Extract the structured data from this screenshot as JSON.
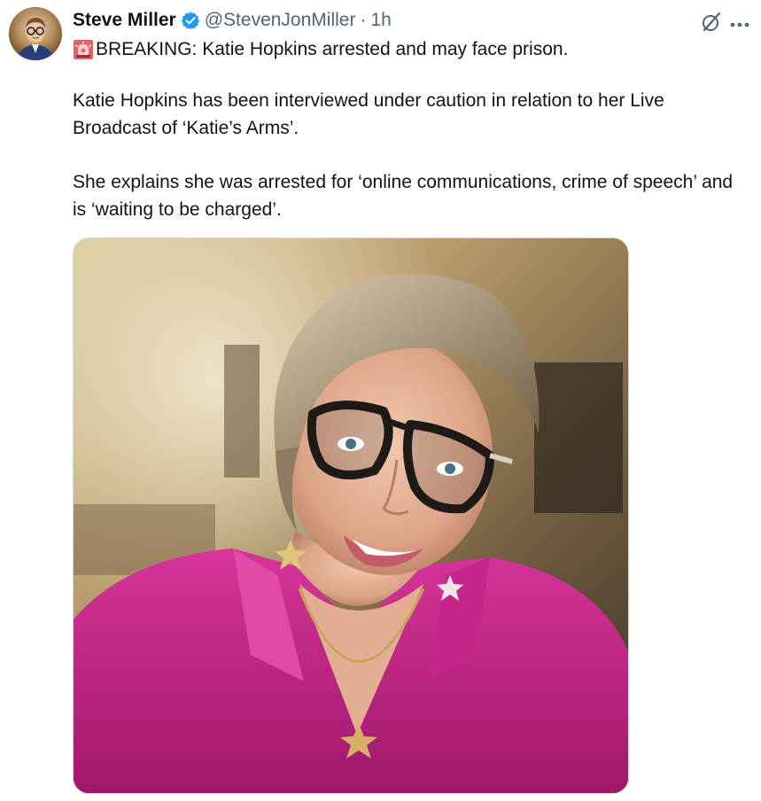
{
  "tweet": {
    "author": {
      "display_name": "Steve Miller",
      "handle": "@StevenJonMiller",
      "separator": "·",
      "time": "1h",
      "verified": true
    },
    "line1_icon": "police-car-light-icon",
    "line1_text": "BREAKING: Katie Hopkins arrested and may face prison.",
    "paragraph2": "Katie Hopkins has been interviewed under caution in relation to her Live Broadcast of ‘Katie’s Arms’.",
    "paragraph3": "She explains she was arrested for ‘online communications, crime of speech’ and is ‘waiting to be charged’.",
    "media": {
      "type": "photo",
      "alt": "Photo of a woman with short blonde hair and dark glasses wearing a magenta blouse"
    }
  },
  "icons": {
    "grok": "grok-icon",
    "more": "more-icon",
    "verified": "verified-badge-icon"
  },
  "colors": {
    "text": "#0f1419",
    "secondary": "#536471",
    "verified_blue": "#1d9bf0",
    "border": "#cfd9de",
    "blouse": "#c0257f"
  }
}
